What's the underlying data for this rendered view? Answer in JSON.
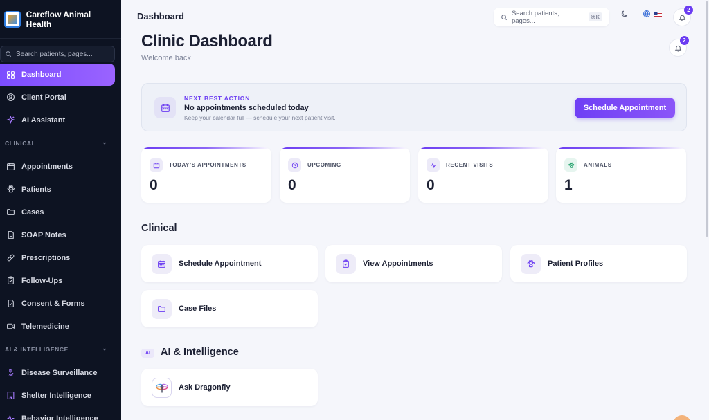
{
  "brand": {
    "name": "Careflow Animal Health"
  },
  "sidebar": {
    "search_placeholder": "Search patients, pages...",
    "items": [
      {
        "label": "Dashboard",
        "icon": "grid-icon",
        "active": true
      },
      {
        "label": "Client Portal",
        "icon": "user-circle-icon"
      },
      {
        "label": "AI Assistant",
        "icon": "sparkles-icon"
      }
    ],
    "clinical_section": "CLINICAL",
    "clinical_items": [
      {
        "label": "Appointments",
        "icon": "calendar-icon"
      },
      {
        "label": "Patients",
        "icon": "paw-icon"
      },
      {
        "label": "Cases",
        "icon": "folder-icon"
      },
      {
        "label": "SOAP Notes",
        "icon": "document-icon"
      },
      {
        "label": "Prescriptions",
        "icon": "pill-icon"
      },
      {
        "label": "Follow-Ups",
        "icon": "clipboard-check-icon"
      },
      {
        "label": "Consent & Forms",
        "icon": "file-check-icon"
      },
      {
        "label": "Telemedicine",
        "icon": "video-icon"
      }
    ],
    "ai_section": "AI & INTELLIGENCE",
    "ai_items": [
      {
        "label": "Disease Surveillance",
        "icon": "microscope-icon"
      },
      {
        "label": "Shelter Intelligence",
        "icon": "building-icon"
      },
      {
        "label": "Behavior Intelligence",
        "icon": "activity-icon"
      }
    ]
  },
  "topbar": {
    "title": "Dashboard",
    "search_placeholder": "Search patients, pages...",
    "shortcut": "⌘K",
    "notification_count": "2"
  },
  "page": {
    "title": "Clinic Dashboard",
    "subtitle": "Welcome back",
    "notification_count": "2"
  },
  "next_best_action": {
    "eyebrow": "NEXT BEST ACTION",
    "title": "No appointments scheduled today",
    "description": "Keep your calendar full — schedule your next patient visit.",
    "button": "Schedule Appointment"
  },
  "stats": [
    {
      "label": "TODAY'S APPOINTMENTS",
      "value": "0",
      "icon": "calendar-icon"
    },
    {
      "label": "UPCOMING",
      "value": "0",
      "icon": "clock-icon"
    },
    {
      "label": "RECENT VISITS",
      "value": "0",
      "icon": "activity-icon"
    },
    {
      "label": "ANIMALS",
      "value": "1",
      "icon": "paw-icon"
    }
  ],
  "clinical": {
    "title": "Clinical",
    "actions": [
      {
        "label": "Schedule Appointment",
        "icon": "calendar-icon"
      },
      {
        "label": "View Appointments",
        "icon": "clipboard-check-icon"
      },
      {
        "label": "Patient Profiles",
        "icon": "paw-icon"
      },
      {
        "label": "Case Files",
        "icon": "folder-icon"
      }
    ]
  },
  "ai": {
    "chip": "AI",
    "title": "AI & Intelligence",
    "actions": [
      {
        "label": "Ask Dragonfly",
        "icon": "dragonfly-icon"
      }
    ]
  },
  "colors": {
    "accent": "#6b3cf2",
    "sidebar_bg": "#0d1322",
    "page_bg": "#f5f6fb"
  }
}
